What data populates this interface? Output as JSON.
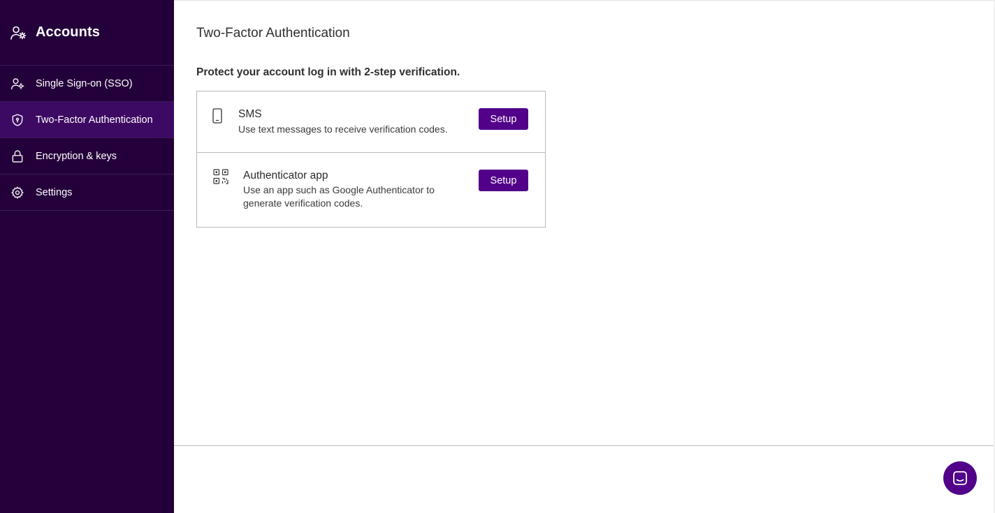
{
  "sidebar": {
    "title": "Accounts",
    "header_icon": "user-gear-icon",
    "items": [
      {
        "label": "Single Sign-on (SSO)",
        "icon": "user-gear-icon",
        "active": false
      },
      {
        "label": "Two-Factor Authentication",
        "icon": "shield-icon",
        "active": true
      },
      {
        "label": "Encryption & keys",
        "icon": "lock-icon",
        "active": false
      },
      {
        "label": "Settings",
        "icon": "gear-icon",
        "active": false
      }
    ]
  },
  "main": {
    "title": "Two-Factor Authentication",
    "subtitle": "Protect your account log in with 2-step verification.",
    "methods": [
      {
        "title": "SMS",
        "description": "Use text messages to receive verification codes.",
        "icon": "smartphone-icon",
        "button_label": "Setup"
      },
      {
        "title": "Authenticator app",
        "description": "Use an app such as Google Authenticator to generate verification codes.",
        "icon": "qr-code-icon",
        "button_label": "Setup"
      }
    ]
  },
  "chat": {
    "icon": "chat-icon"
  },
  "colors": {
    "sidebar_bg": "#24003a",
    "sidebar_active": "#3d0a63",
    "accent": "#520089"
  }
}
